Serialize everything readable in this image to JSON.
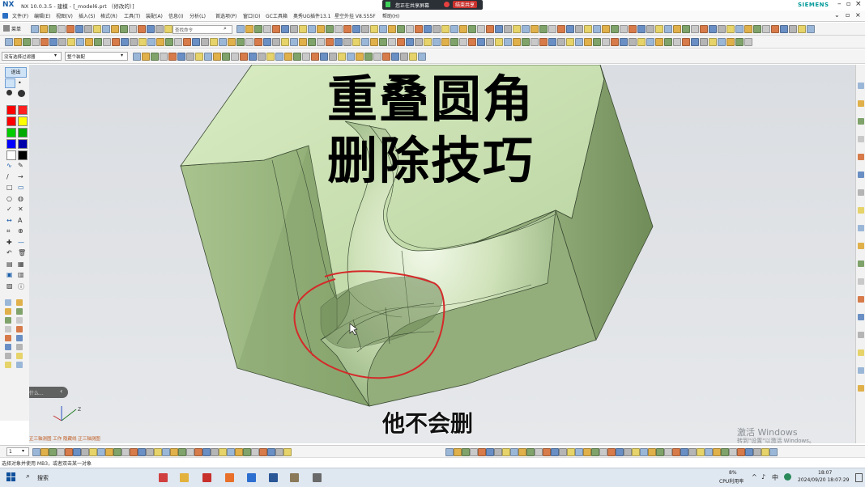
{
  "window": {
    "app_logo": "NX",
    "title": "NX 10.0.3.5 - 建模 - [_model6.prt （修改的）]",
    "brand": "SIEMENS",
    "share_status": "您正在共享屏幕",
    "share_stop": "结束共享"
  },
  "menu": [
    "文件(F)",
    "编辑(E)",
    "视图(V)",
    "插入(S)",
    "格式(R)",
    "工具(T)",
    "装配(A)",
    "信息(I)",
    "分析(L)",
    "首选项(P)",
    "窗口(O)",
    "GC工具箱",
    "奥秀UG插件13.1",
    "星空外挂 V8.555F",
    "帮助(H)"
  ],
  "toolbar": {
    "menu_label": "菜单",
    "search_placeholder": "查找命令",
    "filter_select": "没有选择过滤器",
    "assembly_select": "整个装配"
  },
  "left_panel": {
    "exit_button": "退出",
    "colors": [
      "#ff0000",
      "#ff2020",
      "#ff0000",
      "#ffff00",
      "#00cc00",
      "#00aa00",
      "#0000ff",
      "#0000aa",
      "#ffffff",
      "#000000"
    ],
    "notification": "是否什么..."
  },
  "overlay": {
    "title_line1": "重叠圆角",
    "title_line2": "删除技巧",
    "subtitle": "他不会删"
  },
  "viewport": {
    "watermark_line1": "激活 Windows",
    "watermark_line2": "转到\"设置\"以激活 Windows。",
    "coord_label": "正三轴测图 工作 隐藏线 正三轴测图"
  },
  "bottom_toolbar": {
    "selector_value": "1"
  },
  "status": {
    "message": "选择对象并使用 MB3，或者双击某一对象"
  },
  "taskbar": {
    "search_label": "搜索",
    "cpu_value": "8%",
    "cpu_label": "CPU利用率",
    "ime": "中",
    "time": "18:07",
    "date": "2024/09/20 18:07:29"
  }
}
